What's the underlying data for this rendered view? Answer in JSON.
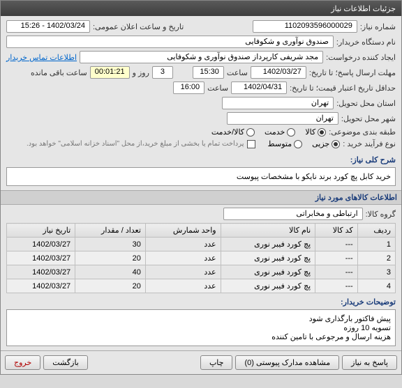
{
  "title": "جزئیات اطلاعات نیاز",
  "f": {
    "need_no_lbl": "شماره نیاز:",
    "need_no": "1102093596000029",
    "announce_lbl": "تاریخ و ساعت اعلان عمومی:",
    "announce": "1402/03/24 - 15:26",
    "buyer_lbl": "نام دستگاه خریدار:",
    "buyer": "صندوق نوآوری و شکوفایی",
    "creator_lbl": "ایجاد کننده درخواست:",
    "creator": "مجد  شریفی کارپرداز صندوق نوآوری و شکوفایی",
    "contact_link": "اطلاعات تماس خریدار",
    "deadline_lbl": "مهلت ارسال پاسخ؛ تا تاریخ:",
    "deadline_date": "1402/03/27",
    "hour_lbl": "ساعت",
    "deadline_time": "15:30",
    "days_left_lbl": "روز و",
    "days_left": "3",
    "time_left": "00:01:21",
    "time_left_lbl": "ساعت باقی مانده",
    "valid_lbl": "حداقل تاریخ اعتبار قیمت؛ تا تاریخ:",
    "valid_date": "1402/04/31",
    "valid_time": "16:00",
    "delivery_state_lbl": "استان محل تحویل:",
    "delivery_state": "تهران",
    "delivery_city_lbl": "شهر محل تحویل:",
    "delivery_city": "تهران",
    "cat_lbl": "طبقه بندی موضوعی:",
    "cat_kala": "کالا",
    "cat_khadamat": "خدمت",
    "cat_both": "کالا/خدمت",
    "type_lbl": "نوع فرآیند خرید :",
    "type_partial": "جزیی",
    "type_mid": "متوسط",
    "payment_note": "پرداخت تمام یا بخشی از مبلغ خرید،از محل \"اسناد خزانه اسلامی\" خواهد بود.",
    "summary_lbl": "شرح کلی نیاز:",
    "summary": "خرید کابل پچ کورد برند نایکو با مشخصات پیوست",
    "items_title": "اطلاعات کالاهای مورد نیاز",
    "group_lbl": "گروه کالا:",
    "group": "ارتباطی و مخابراتی"
  },
  "cols": {
    "row": "ردیف",
    "code": "کد کالا",
    "name": "نام کالا",
    "unit": "واحد شمارش",
    "qty": "تعداد / مقدار",
    "date": "تاریخ نیاز"
  },
  "rows": [
    {
      "n": "1",
      "code": "---",
      "name": "پچ کورد فیبر نوری",
      "unit": "عدد",
      "qty": "30",
      "date": "1402/03/27"
    },
    {
      "n": "2",
      "code": "---",
      "name": "پچ کورد فیبر نوری",
      "unit": "عدد",
      "qty": "20",
      "date": "1402/03/27"
    },
    {
      "n": "3",
      "code": "---",
      "name": "پچ کورد فیبر نوری",
      "unit": "عدد",
      "qty": "40",
      "date": "1402/03/27"
    },
    {
      "n": "4",
      "code": "---",
      "name": "پچ کورد فیبر نوری",
      "unit": "عدد",
      "qty": "20",
      "date": "1402/03/27"
    }
  ],
  "notes_lbl": "توضیحات خریدار:",
  "notes1": "پیش فاکتور بارگذاری شود",
  "notes2": "تسویه 10 روزه",
  "notes3": "هزینه ارسال و مرجوعی با تامین کننده",
  "btns": {
    "reply": "پاسخ به نیاز",
    "attach": "مشاهده مدارک پیوستی (0)",
    "print": "چاپ",
    "back": "بازگشت",
    "exit": "خروج"
  }
}
